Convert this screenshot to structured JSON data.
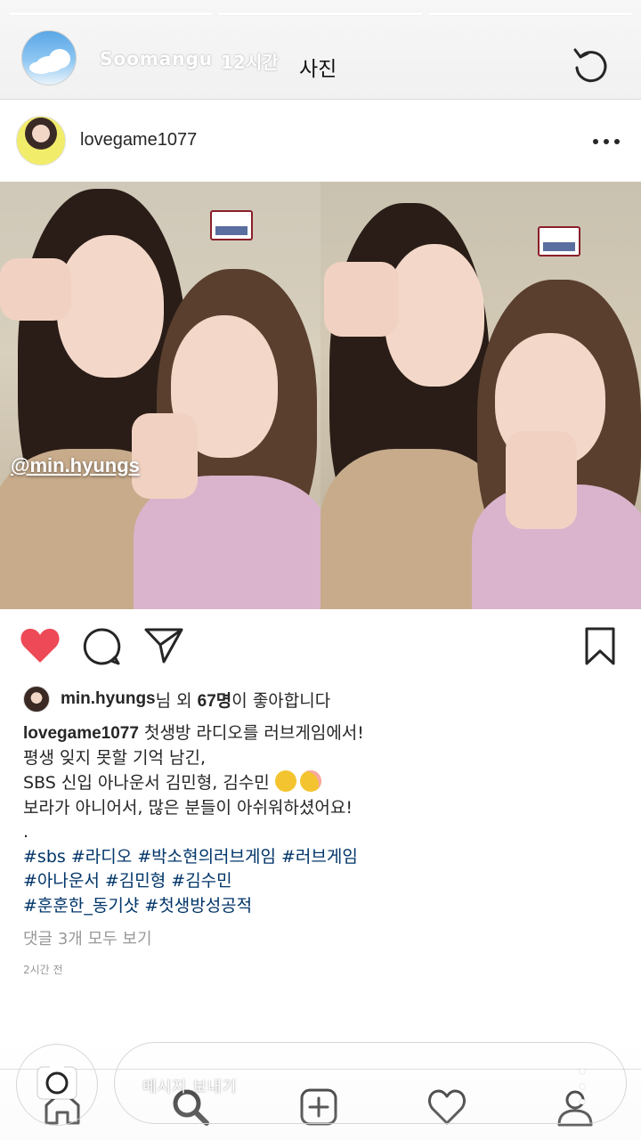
{
  "story": {
    "progress": [
      1,
      0,
      0
    ],
    "username": "Soomangu",
    "time": "12시간",
    "label": "사진"
  },
  "post": {
    "username": "lovegame1077",
    "photo_mention": "@min.hyungs",
    "likes": {
      "user": "min.hyungs",
      "text_mid": "님 외 ",
      "count": "67명",
      "text_end": "이 좋아합니다"
    },
    "caption": {
      "username": "lovegame1077",
      "line1": " 첫생방 라디오를 러브게임에서!",
      "line2": "평생 잊지 못할 기억 남긴,",
      "line3": "SBS 신입 아나운서 김민형, 김수민 ",
      "line4": "보라가 아니어서, 많은 분들이 아쉬워하셨어요!",
      "line5": ".",
      "tags1": "#sbs #라디오 #박소현의러브게임 #러브게임",
      "tags2": "#아나운서 #김민형 #김수민",
      "tags3": "#훈훈한_동기샷 #첫생방성공적"
    },
    "comments_link": "댓글 3개 모두 보기",
    "timestamp": "2시간 전"
  },
  "reply": {
    "placeholder": "메시지 보내기"
  },
  "icons": {
    "like": "heart-filled-icon",
    "comment": "comment-icon",
    "share": "paper-plane-icon",
    "save": "bookmark-icon",
    "refresh": "refresh-icon",
    "camera": "camera-icon",
    "tabs": [
      "home-icon",
      "search-icon",
      "add-icon",
      "activity-icon",
      "profile-icon"
    ]
  },
  "colors": {
    "like_red": "#ed4956",
    "hashtag": "#003569",
    "muted": "#999999"
  }
}
